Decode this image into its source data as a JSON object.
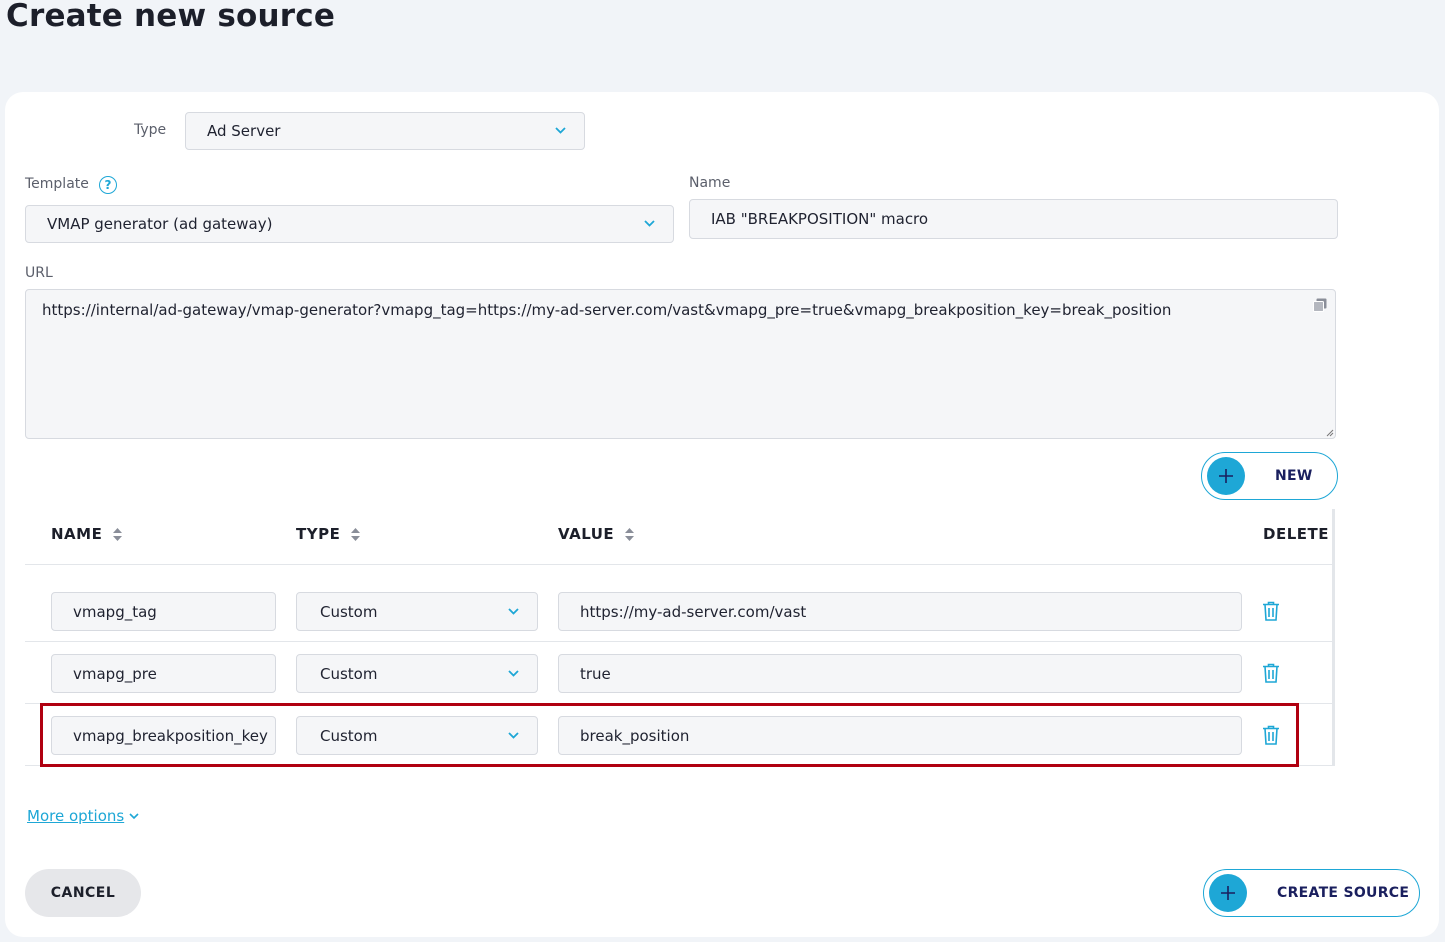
{
  "page": {
    "title": "Create new source"
  },
  "form": {
    "type_label": "Type",
    "type_value": "Ad Server",
    "template_label": "Template",
    "template_help": "?",
    "template_value": "VMAP generator (ad gateway)",
    "name_label": "Name",
    "name_value": "IAB \"BREAKPOSITION\" macro",
    "url_label": "URL",
    "url_value": "https://internal/ad-gateway/vmap-generator?vmapg_tag=https://my-ad-server.com/vast&vmapg_pre=true&vmapg_breakposition_key=break_position"
  },
  "params": {
    "new_button_label": "NEW",
    "columns": {
      "name": "NAME",
      "type": "TYPE",
      "value": "VALUE",
      "delete": "DELETE"
    },
    "rows": [
      {
        "name": "vmapg_tag",
        "type": "Custom",
        "value": "https://my-ad-server.com/vast"
      },
      {
        "name": "vmapg_pre",
        "type": "Custom",
        "value": "true"
      },
      {
        "name": "vmapg_breakposition_key",
        "type": "Custom",
        "value": "break_position"
      }
    ]
  },
  "footer": {
    "more_options_label": "More options",
    "cancel_label": "CANCEL",
    "create_label": "CREATE SOURCE"
  },
  "colors": {
    "accent": "#1ea7d6",
    "button_text": "#1a1f5e",
    "highlight": "#b00010",
    "page_bg": "#f1f4f8"
  }
}
